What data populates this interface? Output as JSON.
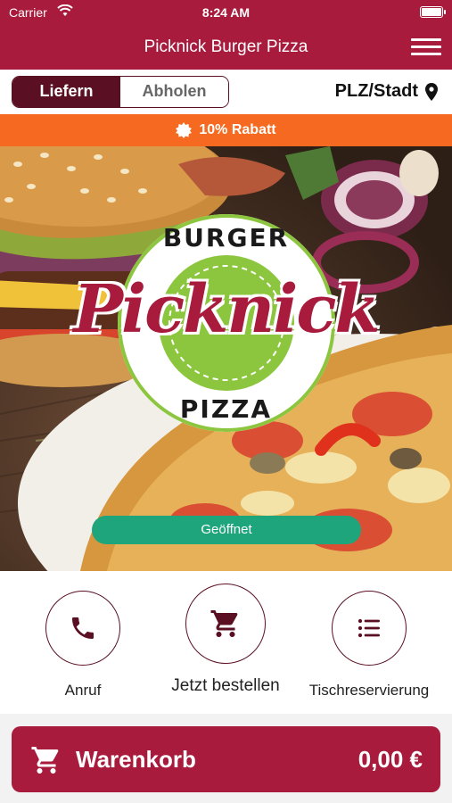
{
  "status_bar": {
    "carrier": "Carrier",
    "time": "8:24 AM"
  },
  "navbar": {
    "title": "Picknick Burger Pizza"
  },
  "order_mode": {
    "options": [
      "Liefern",
      "Abholen"
    ],
    "selected": "Liefern"
  },
  "location": {
    "label": "PLZ/Stadt"
  },
  "promo": {
    "text": "10% Rabatt"
  },
  "logo": {
    "top_text": "BURGER",
    "main_text": "Picknick",
    "bottom_text": "PIZZA"
  },
  "open_status": {
    "text": "Geöffnet"
  },
  "actions": [
    {
      "label": "Anruf",
      "icon": "phone-icon"
    },
    {
      "label": "Jetzt bestellen",
      "icon": "cart-icon"
    },
    {
      "label": "Tischreservierung",
      "icon": "list-icon"
    }
  ],
  "cart": {
    "label": "Warenkorb",
    "total": "0,00 €"
  },
  "colors": {
    "brand": "#a81b3c",
    "dark": "#5a0f22",
    "promo": "#f56a20",
    "open": "#1fa57c",
    "logo_green": "#8cc63f"
  }
}
